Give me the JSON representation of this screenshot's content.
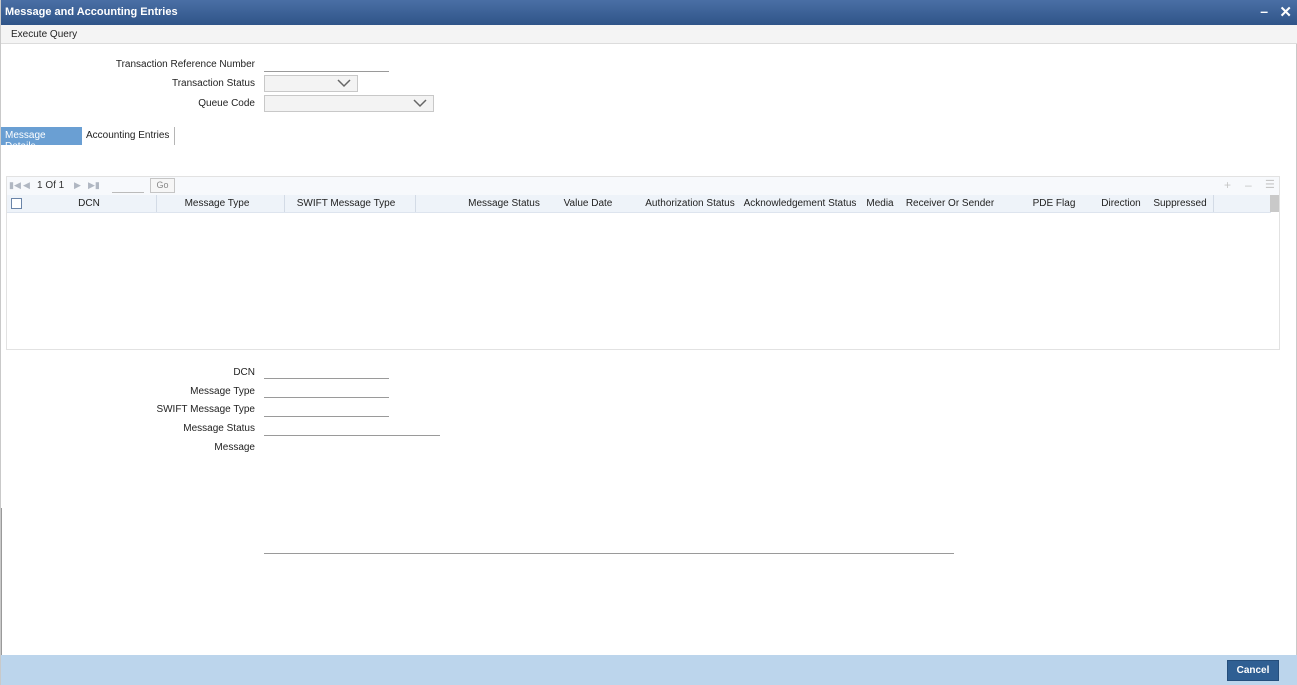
{
  "window": {
    "title": "Message and Accounting Entries"
  },
  "menu": {
    "execute_query": "Execute Query"
  },
  "form": {
    "trn_label": "Transaction Reference Number",
    "trn_value": "",
    "status_label": "Transaction Status",
    "queue_label": "Queue Code"
  },
  "tabs": [
    {
      "label": "Message Details",
      "active": true
    },
    {
      "label": "Accounting Entries",
      "active": false
    }
  ],
  "pager": {
    "text": "1 Of 1",
    "go": "Go"
  },
  "grid": {
    "columns": [
      "DCN",
      "Message Type",
      "SWIFT Message Type",
      "Message Status",
      "Value Date",
      "Authorization Status",
      "Acknowledgement Status",
      "Media",
      "Receiver Or Sender",
      "PDE Flag",
      "Direction",
      "Suppressed"
    ],
    "rows": []
  },
  "detail": {
    "dcn_label": "DCN",
    "msgtype_label": "Message Type",
    "swift_label": "SWIFT Message Type",
    "msgstatus_label": "Message Status",
    "message_label": "Message"
  },
  "footer": {
    "cancel": "Cancel"
  },
  "colors": {
    "title_bar": "#2f5488",
    "active_tab": "#6a9fd3",
    "footer": "#bcd5ec",
    "button": "#2f5f93"
  }
}
